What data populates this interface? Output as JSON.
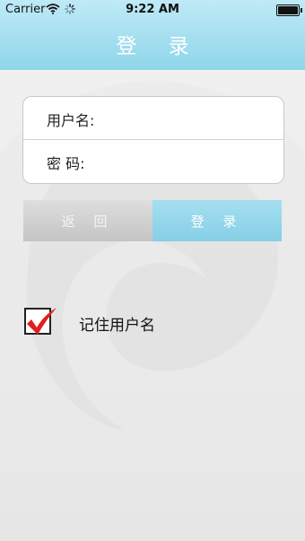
{
  "status_bar": {
    "carrier": "Carrier",
    "time": "9:22 AM",
    "icons": [
      "wifi-icon",
      "activity-spinner-icon",
      "battery-icon"
    ]
  },
  "header": {
    "title": "登 录",
    "background": "#a6def0"
  },
  "form": {
    "username_label": "用户名:",
    "username_value": "",
    "password_label": "密 码:",
    "password_value": ""
  },
  "buttons": {
    "back_label": "返 回",
    "login_label": "登 录",
    "back_color": "#d0d0d0",
    "login_color": "#95d6ea"
  },
  "remember": {
    "label": "记住用户名",
    "checked": true,
    "check_color": "#e02020"
  }
}
